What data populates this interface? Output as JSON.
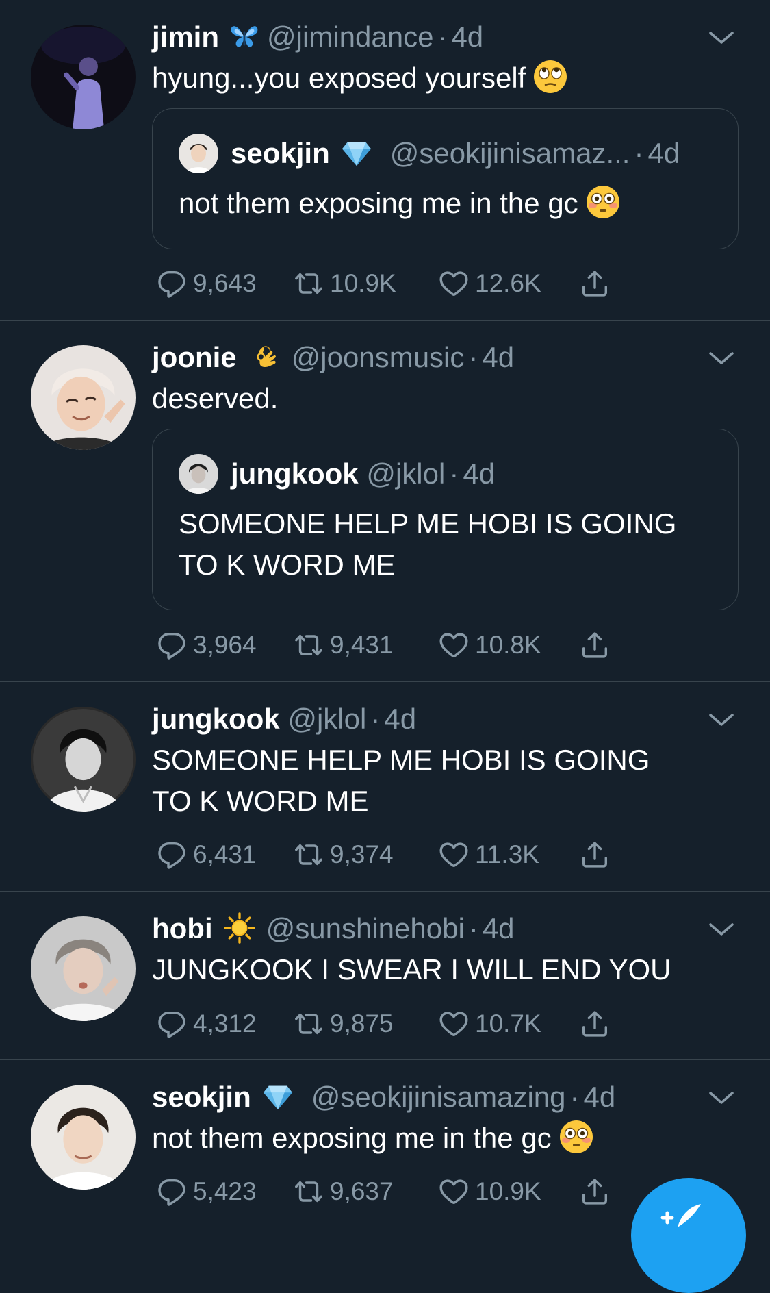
{
  "colors": {
    "background": "#15202b",
    "divider": "#38444d",
    "secondary_text": "#8899a6",
    "accent": "#1da1f2"
  },
  "tweets": [
    {
      "name": "jimin",
      "badge_icon": "butterfly-icon",
      "handle": "@jimindance",
      "dot": "·",
      "time": "4d",
      "text": "hyung...you exposed yourself",
      "text_emoji": "face-with-rolling-eyes-emoji",
      "quote": {
        "name": "seokjin",
        "badge_icon": "gem-icon",
        "handle": "@seokijinisamaz...",
        "dot": "·",
        "time": "4d",
        "text": "not them exposing me in the gc",
        "text_emoji": "flushed-face-emoji"
      },
      "replies": "9,643",
      "retweets": "10.9K",
      "likes": "12.6K"
    },
    {
      "name": "joonie",
      "badge_icon": "ok-hand-icon",
      "handle": "@joonsmusic",
      "dot": "·",
      "time": "4d",
      "text": "deserved.",
      "quote": {
        "name": "jungkook",
        "handle": "@jklol",
        "dot": "·",
        "time": "4d",
        "text": "SOMEONE HELP ME HOBI IS GOING TO K WORD ME"
      },
      "replies": "3,964",
      "retweets": "9,431",
      "likes": "10.8K"
    },
    {
      "name": "jungkook",
      "handle": "@jklol",
      "dot": "·",
      "time": "4d",
      "text": "SOMEONE HELP ME HOBI IS GOING TO K WORD ME",
      "replies": "6,431",
      "retweets": "9,374",
      "likes": "11.3K"
    },
    {
      "name": "hobi",
      "badge_icon": "sun-icon",
      "handle": "@sunshinehobi",
      "dot": "·",
      "time": "4d",
      "text": "JUNGKOOK I SWEAR I WILL END YOU",
      "replies": "4,312",
      "retweets": "9,875",
      "likes": "10.7K"
    },
    {
      "name": "seokjin",
      "badge_icon": "gem-icon",
      "handle": "@seokijinisamazing",
      "dot": "·",
      "time": "4d",
      "text": "not them exposing me in the gc",
      "text_emoji": "flushed-face-emoji",
      "replies": "5,423",
      "retweets": "9,637",
      "likes": "10.9K"
    }
  ],
  "fab": {
    "icon": "compose-tweet-icon"
  }
}
